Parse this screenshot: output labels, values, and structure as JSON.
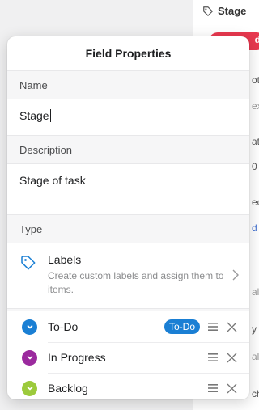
{
  "background": {
    "column_header": "Stage",
    "fragments": [
      "d",
      "ot",
      "ex",
      "at",
      "0",
      "ec",
      "d a",
      "al",
      "y",
      "al",
      "ch"
    ]
  },
  "popover": {
    "title": "Field Properties",
    "name_section": {
      "heading": "Name",
      "value": "Stage"
    },
    "description_section": {
      "heading": "Description",
      "value": "Stage of task"
    },
    "type_section": {
      "heading": "Type",
      "type_name": "Labels",
      "type_description": "Create custom labels and assign them to items.",
      "icon": "tag-icon"
    },
    "labels": [
      {
        "name": "To-Do",
        "color": "#1a7fd4",
        "tag": "To-Do",
        "tag_color": "#1a7fd4"
      },
      {
        "name": "In Progress",
        "color": "#9b2a9e",
        "tag": ""
      },
      {
        "name": "Backlog",
        "color": "#9cca3c",
        "tag": ""
      }
    ]
  },
  "colors": {
    "accent_blue": "#4573d2",
    "tag_blue": "#1a7fd4",
    "red_pill": "#e8384f"
  }
}
